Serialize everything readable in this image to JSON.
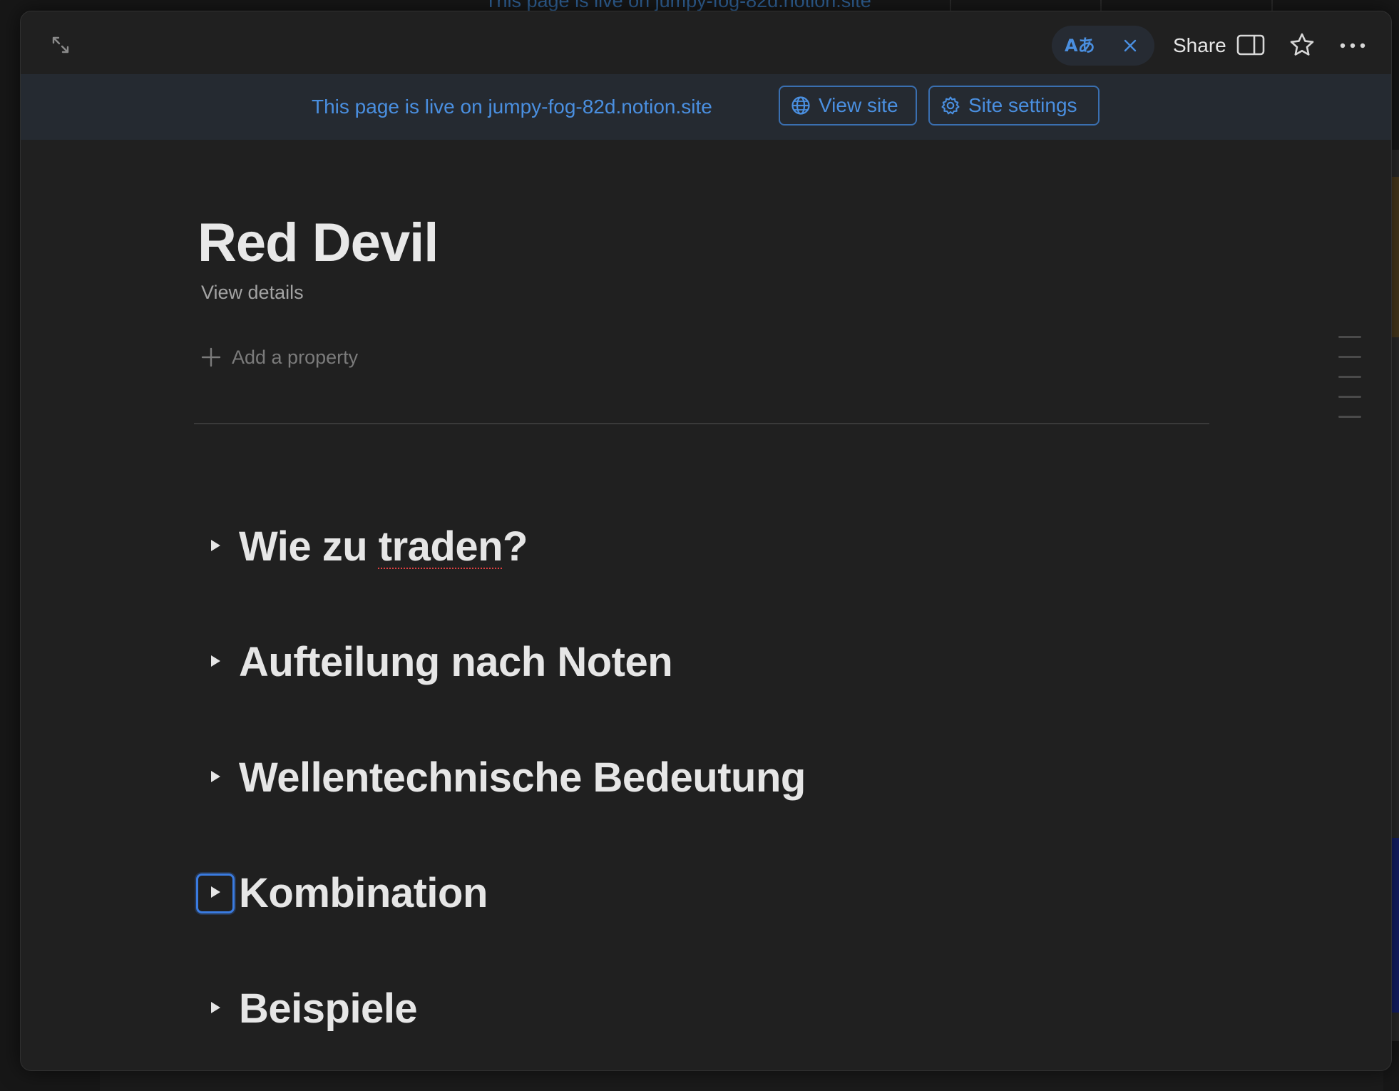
{
  "background": {
    "banner_text": "This page is live on jumpy-fog-82d.notion.site",
    "colors": {
      "accent_orange": "#4a3a1c",
      "accent_blue": "#14206a"
    }
  },
  "topbar": {
    "expand_icon": "expand-arrows-icon",
    "translate_label": "Aあ",
    "translate_close_icon": "close-icon",
    "share_label": "Share",
    "panel_icon": "side-panel-icon",
    "star_icon": "star-icon",
    "more_icon": "more-horizontal-icon"
  },
  "banner": {
    "text": "This page is live on jumpy-fog-82d.notion.site",
    "view_site_label": "View site",
    "view_site_icon": "globe-icon",
    "site_settings_label": "Site settings",
    "site_settings_icon": "gear-icon"
  },
  "page": {
    "title": "Red Devil",
    "view_details": "View details",
    "add_property": "Add a property"
  },
  "toggles": [
    {
      "label_prefix": "Wie zu ",
      "label_misspelled": "traden",
      "label_suffix": "?",
      "focused": false
    },
    {
      "label": "Aufteilung nach Noten",
      "focused": false
    },
    {
      "label": "Wellentechnische Bedeutung",
      "focused": false
    },
    {
      "label": "Kombination",
      "focused": true
    },
    {
      "label": "Beispiele",
      "focused": false
    }
  ],
  "colors": {
    "accent": "#4a8fe0",
    "modal_bg": "#202020",
    "banner_bg": "#252a31",
    "focus_ring": "#3a7be0"
  }
}
